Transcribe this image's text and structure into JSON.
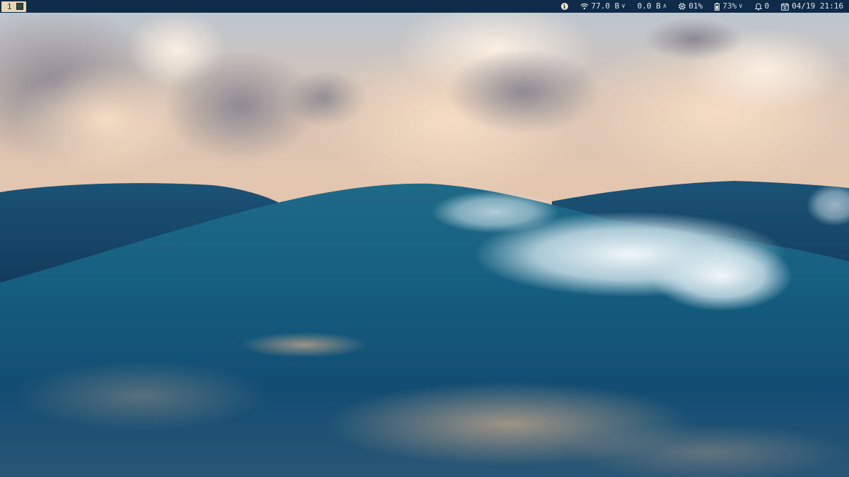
{
  "workspace": {
    "number": "1"
  },
  "status": {
    "network_down": "77.0 B",
    "network_up": "0.0 B",
    "cpu": "01%",
    "battery": "73%",
    "notifications": "0",
    "datetime": "04/19 21:16"
  },
  "icons": {
    "info": "info-icon",
    "wifi": "wifi-icon",
    "cpu": "cpu-icon",
    "battery": "battery-icon",
    "bell": "bell-icon",
    "calendar": "calendar-icon"
  },
  "colors": {
    "bar_background": "#0f2b4a",
    "workspace_active": "#e8d7b4",
    "text": "#e6e6e6"
  }
}
